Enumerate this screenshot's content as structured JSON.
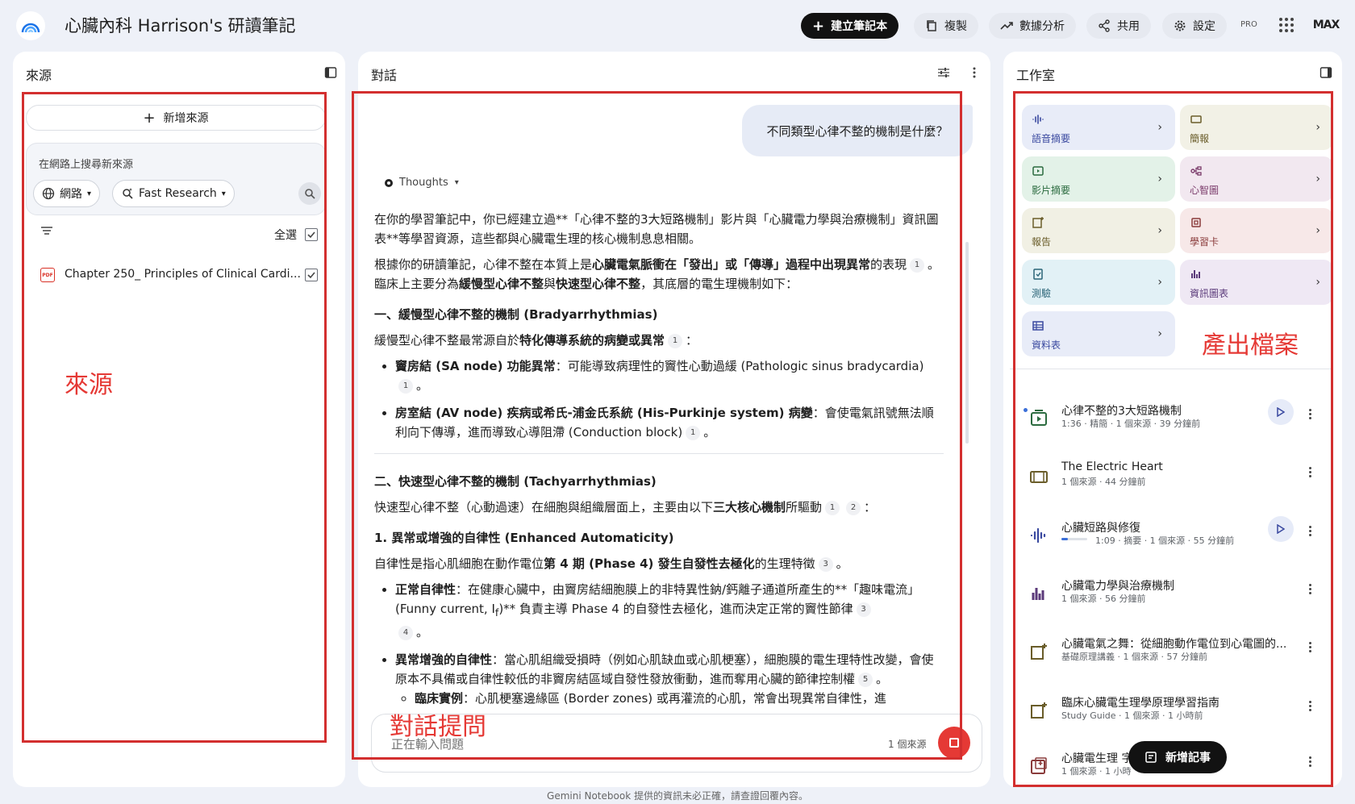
{
  "app": {
    "title": "心臟內科 Harrison's 研讀筆記",
    "pro_badge": "PRO",
    "avatar": "MAX"
  },
  "toolbar": {
    "create_notebook": "建立筆記本",
    "copy": "複製",
    "analytics": "數據分析",
    "share": "共用",
    "settings": "設定"
  },
  "sources": {
    "title": "來源",
    "add_source": "新增來源",
    "search_placeholder": "在網路上搜尋新來源",
    "web_chip": "網路",
    "research_chip": "Fast Research",
    "select_all": "全選",
    "items": [
      {
        "name": "Chapter 250_ Principles of Clinical Cardi...",
        "checked": true
      }
    ],
    "annotation": "來源"
  },
  "chat": {
    "title": "對話",
    "user_message": "不同類型心律不整的機制是什麼？",
    "thoughts": "Thoughts",
    "composer_placeholder": "正在輸入問題",
    "source_count": "1 個來源",
    "annotation": "對話提問",
    "footer": "Gemini Notebook 提供的資訊未必正確，請查證回覆內容。"
  },
  "answer": {
    "p1": "在你的學習筆記中，你已經建立過**「心律不整的3大短路機制」影片與「心臟電力學與治療機制」資訊圖表**等學習資源，這些都與心臟電生理的核心機制息息相關。",
    "p2_a": "根據你的研讀筆記，心律不整在本質上是",
    "p2_b": "心臟電氣脈衝在「發出」或「傳導」過程中出現異常",
    "p2_c": "的表現",
    "p2_d": "。臨床上主要分為",
    "p2_e": "緩慢型心律不整",
    "p2_f": "與",
    "p2_g": "快速型心律不整",
    "p2_h": "，其底層的電生理機制如下：",
    "h1": "一、緩慢型心律不整的機制 (Bradyarrhythmias)",
    "p3_a": "緩慢型心律不整最常源自於",
    "p3_b": "特化傳導系統的病變或異常",
    "p3_c": "：",
    "li1_a": "竇房結 (SA node) 功能異常",
    "li1_b": "：可能導致病理性的竇性心動過緩 (Pathologic sinus bradycardia)",
    "li2_a": "房室結 (AV node) 疾病或希氏-浦金氏系統 (His-Purkinje system) 病變",
    "li2_b": "：會使電氣訊號無法順利向下傳導，進而導致心導阻滯 (Conduction block)",
    "h2": "二、快速型心律不整的機制 (Tachyarrhythmias)",
    "p4_a": "快速型心律不整（心動過速）在細胞與組織層面上，主要由以下",
    "p4_b": "三大核心機制",
    "p4_c": "所驅動",
    "p4_d": "：",
    "h3": "1. 異常或增強的自律性 (Enhanced Automaticity)",
    "p5_a": "自律性是指心肌細胞在動作電位",
    "p5_b": "第 4 期 (Phase 4) 發生自發性去極化",
    "p5_c": "的生理特徵",
    "li3_a": "正常自律性",
    "li3_b": "：在健康心臟中，由竇房結細胞膜上的非特異性鈉/鈣離子通道所產生的**「趣味電流」(Funny current, I",
    "li3_sub": "f",
    "li3_c": ")** 負責主導 Phase 4 的自發性去極化，進而決定正常的竇性節律",
    "li4_a": "異常增強的自律性",
    "li4_b": "：當心肌組織受損時（例如心肌缺血或心肌梗塞），細胞膜的電生理特性改變，會使原本不具備或自律性較低的非竇房結區域自發性發放衝動，進而奪用心臟的節律控制權",
    "li5_a": "臨床實例",
    "li5_b": "：心肌梗塞邊緣區 (Border zones) 或再灌流的心肌，常會出現異常自律性，進",
    "c1": "1",
    "c2": "2",
    "c3": "3",
    "c4": "4",
    "c5": "5",
    "end": "。"
  },
  "studio": {
    "title": "工作室",
    "annotation": "產出檔案",
    "tiles": [
      {
        "label": "語音摘要",
        "bg": "#e8ecf8",
        "color": "#3b4aa0"
      },
      {
        "label": "簡報",
        "bg": "#f2f1e6",
        "color": "#6a5d2a"
      },
      {
        "label": "影片摘要",
        "bg": "#e3f2e8",
        "color": "#2b6b3f"
      },
      {
        "label": "心智圖",
        "bg": "#f2e8f0",
        "color": "#7a3a6a"
      },
      {
        "label": "報告",
        "bg": "#f1f0e4",
        "color": "#6a5d2a"
      },
      {
        "label": "學習卡",
        "bg": "#f7e8e8",
        "color": "#8a3b3b"
      },
      {
        "label": "測驗",
        "bg": "#e2f1f6",
        "color": "#2a6477"
      },
      {
        "label": "資訊圖表",
        "bg": "#efe8f4",
        "color": "#5b3a7a"
      },
      {
        "label": "資料表",
        "bg": "#e8ecf8",
        "color": "#3b4aa0"
      }
    ],
    "artifacts": [
      {
        "title": "心律不整的3大短路機制",
        "meta": "1:36 · 精簡 · 1 個來源 · 39 分鐘前"
      },
      {
        "title": "The Electric Heart",
        "meta": "1 個來源 · 44 分鐘前"
      },
      {
        "title": "心臟短路與修復",
        "meta": "1:09 · 摘要 · 1 個來源 · 55 分鐘前"
      },
      {
        "title": "心臟電力學與治療機制",
        "meta": "1 個來源 · 56 分鐘前"
      },
      {
        "title": "心臟電氣之舞：從細胞動作電位到心電圖的...",
        "meta": "基礎原理講義 · 1 個來源 · 57 分鐘前"
      },
      {
        "title": "臨床心臟電生理學原理學習指南",
        "meta": "Study Guide · 1 個來源 · 1 小時前"
      },
      {
        "title": "心臟電生理 字",
        "meta": "1 個來源 · 1 小時"
      }
    ],
    "audio_progress": 0.25,
    "new_note": "新增記事"
  }
}
